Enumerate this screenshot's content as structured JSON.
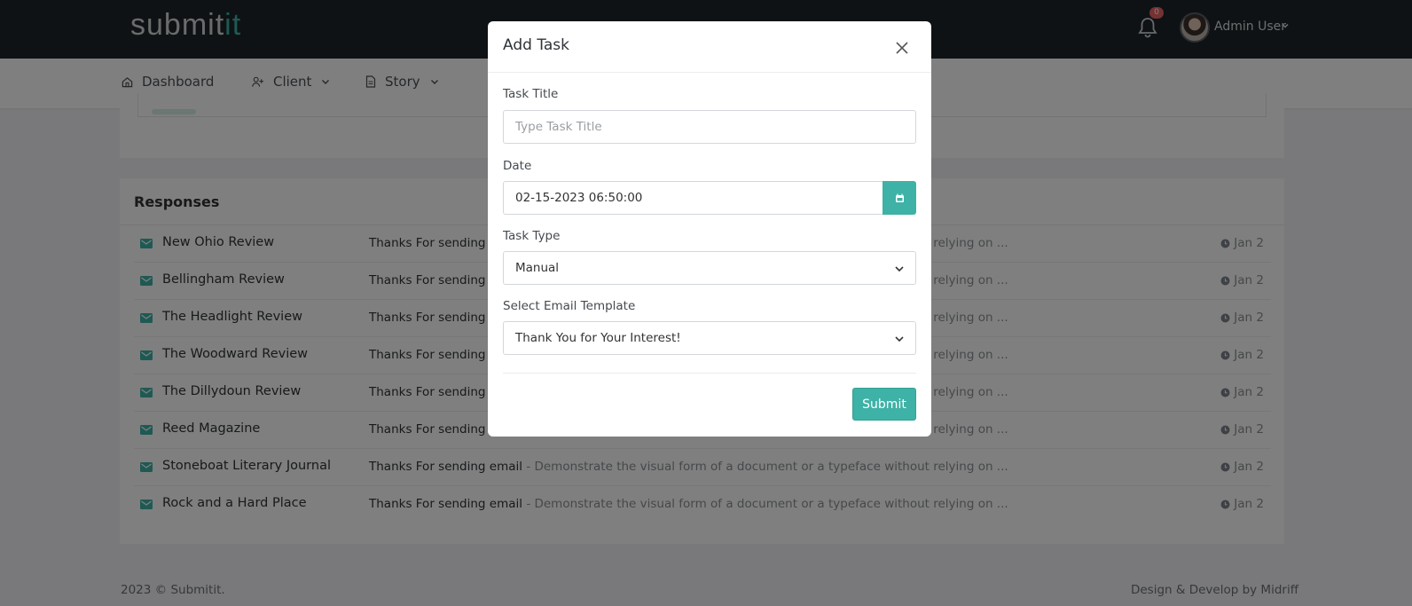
{
  "app": {
    "logo_main": "submit",
    "logo_accent": "it",
    "notification_count": "0",
    "user_name": "Admin User",
    "accent_color": "#3eb2a6"
  },
  "menu": [
    {
      "label": "Dashboard",
      "icon": "home-icon"
    },
    {
      "label": "Client",
      "icon": "user-plus-icon"
    },
    {
      "label": "Story",
      "icon": "document-icon"
    }
  ],
  "responses": {
    "title": "Responses",
    "rows": [
      {
        "name": "New Ohio Review",
        "subject": "Thanks For sending email",
        "desc": " - Demonstrate the visual form of a document or a typeface without relying on ...",
        "date": "Jan 2"
      },
      {
        "name": "Bellingham Review",
        "subject": "Thanks For sending email",
        "desc": " - Demonstrate the visual form of a document or a typeface without relying on ...",
        "date": "Jan 2"
      },
      {
        "name": "The Headlight Review",
        "subject": "Thanks For sending email",
        "desc": " - Demonstrate the visual form of a document or a typeface without relying on ...",
        "date": "Jan 2"
      },
      {
        "name": "The Woodward Review",
        "subject": "Thanks For sending email",
        "desc": " - Demonstrate the visual form of a document or a typeface without relying on ...",
        "date": "Jan 2"
      },
      {
        "name": "The Dillydoun Review",
        "subject": "Thanks For sending email",
        "desc": " - Demonstrate the visual form of a document or a typeface without relying on ...",
        "date": "Jan 2"
      },
      {
        "name": "Reed Magazine",
        "subject": "Thanks For sending email",
        "desc": " - Demonstrate the visual form of a document or a typeface without relying on ...",
        "date": "Jan 2"
      },
      {
        "name": "Stoneboat Literary Journal",
        "subject": "Thanks For sending email",
        "desc": " - Demonstrate the visual form of a document or a typeface without relying on ...",
        "date": "Jan 2"
      },
      {
        "name": "Rock and a Hard Place",
        "subject": "Thanks For sending email",
        "desc": " - Demonstrate the visual form of a document or a typeface without relying on ...",
        "date": "Jan 2"
      }
    ]
  },
  "footer": {
    "left": "2023 © Submitit.",
    "right": "Design & Develop by Midriff"
  },
  "modal": {
    "title": "Add Task",
    "task_title_label": "Task Title",
    "task_title_placeholder": "Type Task Title",
    "task_title_value": "",
    "date_label": "Date",
    "date_value": "02-15-2023 06:50:00",
    "task_type_label": "Task Type",
    "task_type_value": "Manual",
    "email_template_label": "Select Email Template",
    "email_template_value": "Thank You for Your Interest!",
    "submit_label": "Submit"
  }
}
